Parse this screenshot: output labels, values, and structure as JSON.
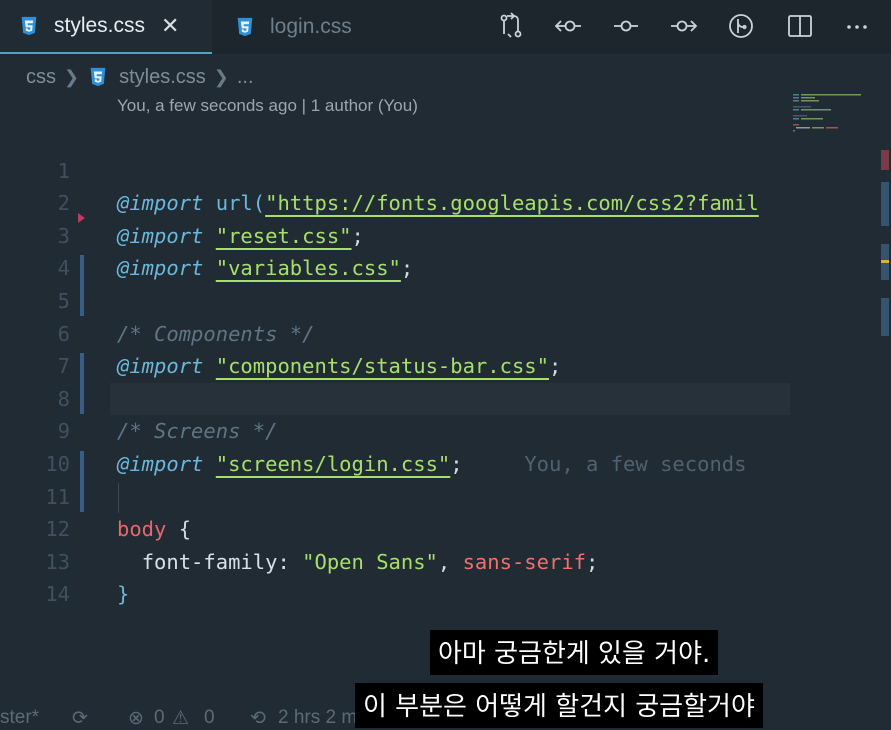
{
  "tabs": [
    {
      "label": "styles.css",
      "active": true,
      "icon": "css-file-icon"
    },
    {
      "label": "login.css",
      "active": false,
      "icon": "css-file-icon"
    }
  ],
  "tab_close_glyph": "✕",
  "breadcrumb": {
    "folder": "css",
    "file": "styles.css",
    "more": "..."
  },
  "blame_header": "You, a few seconds ago | 1 author (You)",
  "lines": [
    {
      "n": "1"
    },
    {
      "n": "2"
    },
    {
      "n": "3"
    },
    {
      "n": "4"
    },
    {
      "n": "5"
    },
    {
      "n": "6"
    },
    {
      "n": "7"
    },
    {
      "n": "8"
    },
    {
      "n": "9"
    },
    {
      "n": "10"
    },
    {
      "n": "11"
    },
    {
      "n": "12"
    },
    {
      "n": "13"
    },
    {
      "n": "14"
    }
  ],
  "code": {
    "import": "@import",
    "url_fn": "url(",
    "font_url": "\"https://fonts.googleapis.com/css2?famil",
    "reset": "\"reset.css\"",
    "variables": "\"variables.css\"",
    "comment_components": "/* Components */",
    "status_bar": "\"components/status-bar.css\"",
    "comment_screens": "/* Screens */",
    "login": "\"screens/login.css\"",
    "semicolon": ";",
    "inline_blame": "You, a few seconds",
    "body_selector": "body",
    "open_brace": "{",
    "close_brace": "}",
    "font_family_prop": "font-family:",
    "open_sans": "\"Open Sans\"",
    "comma": ",",
    "sans_serif": "sans-serif"
  },
  "statusbar": {
    "branch": "ster*",
    "errors": "0",
    "warnings": "0",
    "time": "2 hrs 2 m"
  },
  "subtitles": {
    "line1": "아마 궁금한게 있을 거야.",
    "line2": "이 부분은 어떻게 할건지 궁금할거야"
  },
  "colors": {
    "background": "#212b33",
    "tab_accent": "#4aa6c7",
    "keyword": "#6bb8dc",
    "string": "#a6e06a",
    "selector": "#e8676b"
  }
}
